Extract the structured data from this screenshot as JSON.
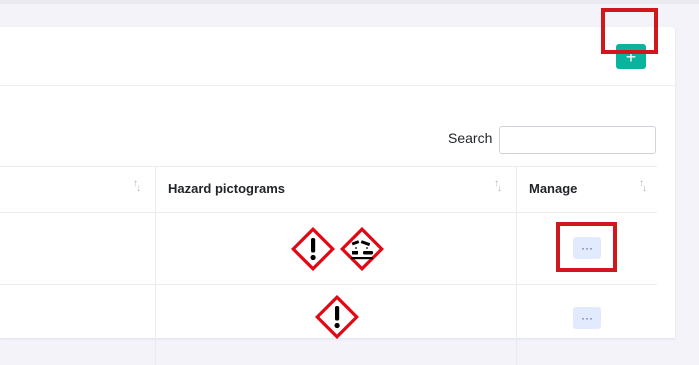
{
  "header": {
    "add_button": {
      "label": "+",
      "color": "#0ab39c"
    }
  },
  "highlight_color": "#d1171e",
  "search": {
    "label": "Search",
    "value": ""
  },
  "table": {
    "columns": [
      "Hazard pictograms",
      "Manage"
    ],
    "sort_glyph": {
      "up": "↑",
      "down": "↓"
    },
    "rows": [
      {
        "pictograms": [
          "exclamation-mark",
          "corrosion"
        ],
        "manage_label": "···"
      },
      {
        "pictograms": [
          "exclamation-mark"
        ],
        "manage_label": "···"
      }
    ]
  }
}
